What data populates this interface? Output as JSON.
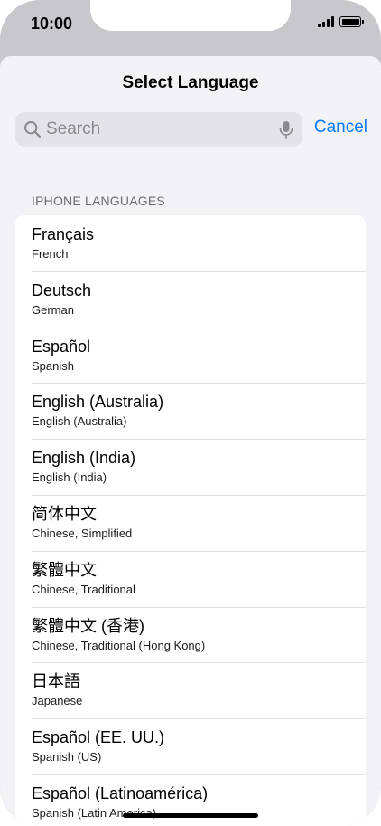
{
  "status_bar": {
    "time": "10:00"
  },
  "sheet": {
    "title": "Select Language",
    "search": {
      "placeholder": "Search",
      "value": ""
    },
    "cancel_label": "Cancel",
    "section_header": "IPHONE LANGUAGES",
    "languages": [
      {
        "name": "Français",
        "sub": "French"
      },
      {
        "name": "Deutsch",
        "sub": "German"
      },
      {
        "name": "Español",
        "sub": "Spanish"
      },
      {
        "name": "English (Australia)",
        "sub": "English (Australia)"
      },
      {
        "name": "English (India)",
        "sub": "English (India)"
      },
      {
        "name": "简体中文",
        "sub": "Chinese, Simplified"
      },
      {
        "name": "繁體中文",
        "sub": "Chinese, Traditional"
      },
      {
        "name": "繁體中文 (香港)",
        "sub": "Chinese, Traditional (Hong Kong)"
      },
      {
        "name": "日本語",
        "sub": "Japanese"
      },
      {
        "name": "Español (EE. UU.)",
        "sub": "Spanish (US)"
      },
      {
        "name": "Español (Latinoamérica)",
        "sub": "Spanish (Latin America)"
      }
    ]
  },
  "colors": {
    "accent": "#0a7aff",
    "background": "#f2f2f7",
    "search_field": "#e3e3e8"
  },
  "icons": {
    "search": "search-icon",
    "mic": "microphone-icon",
    "signal": "cellular-signal-icon",
    "battery": "battery-icon"
  }
}
